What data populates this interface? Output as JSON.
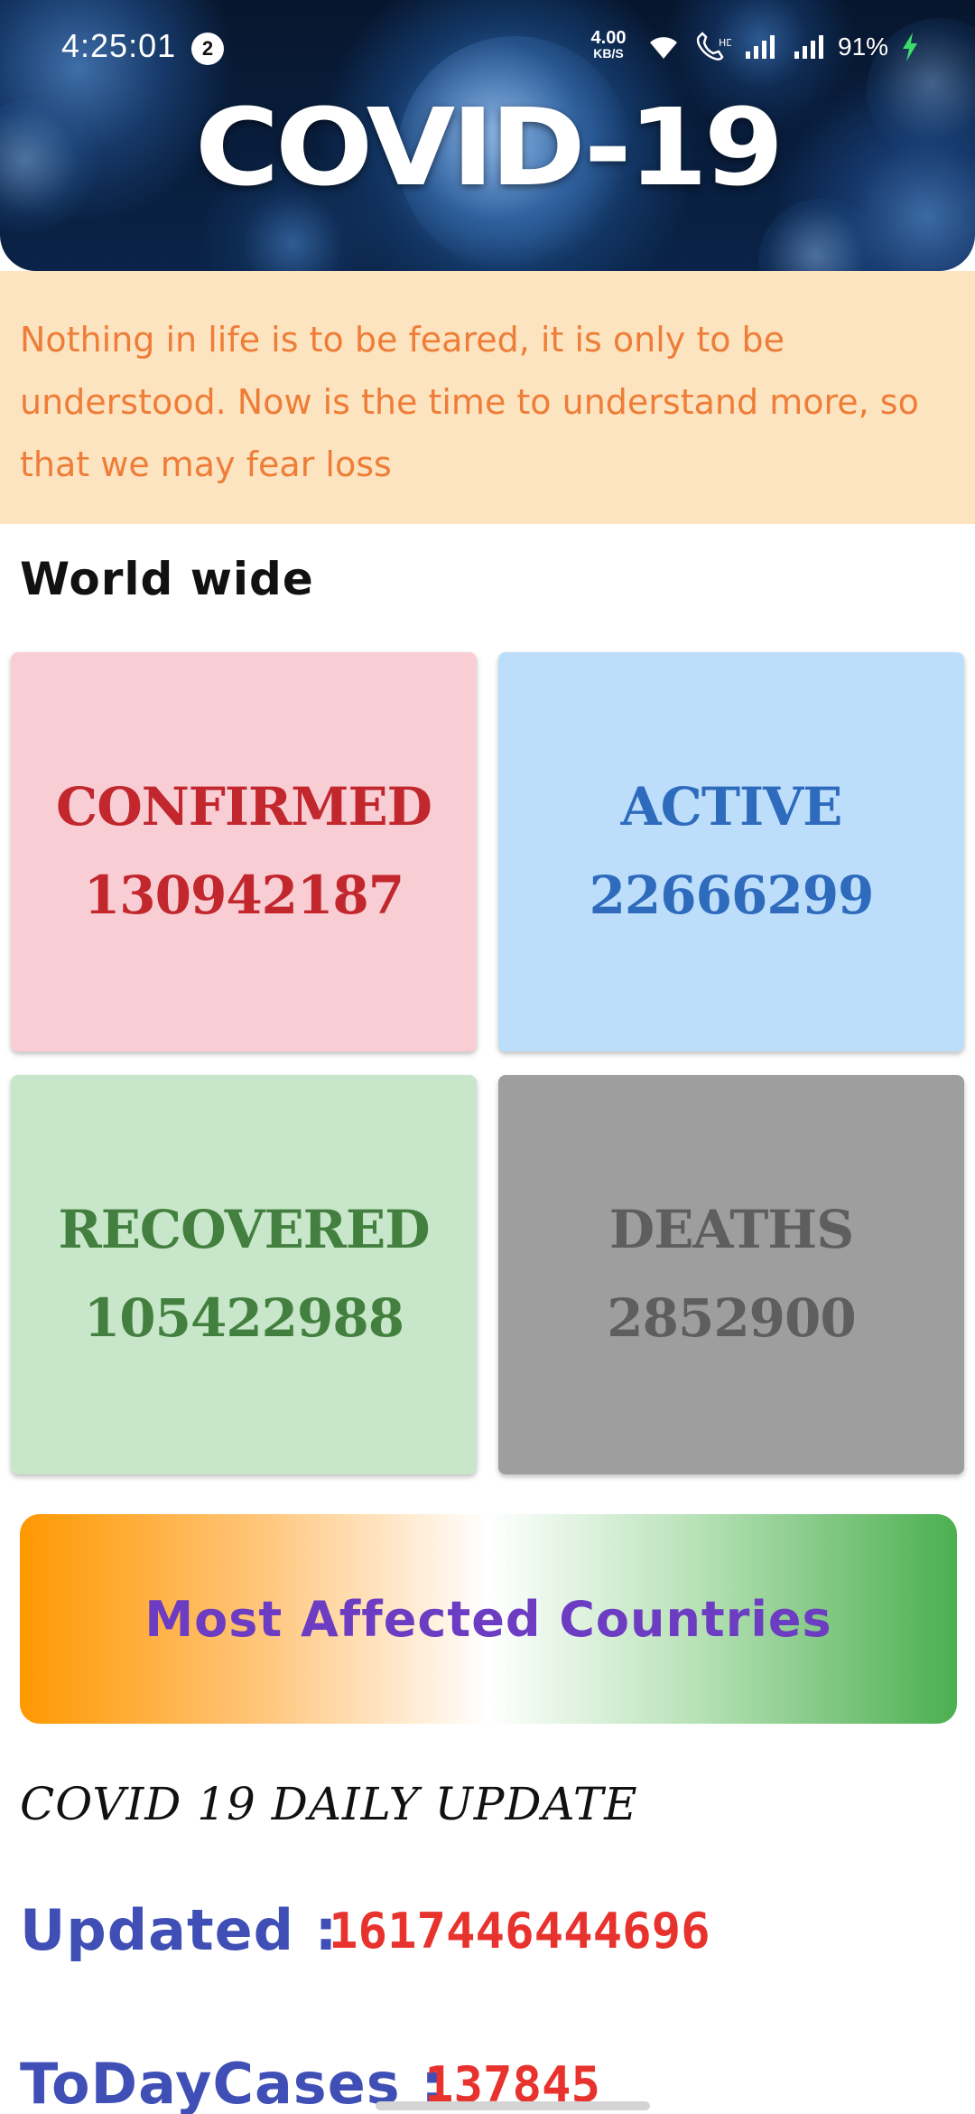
{
  "status_bar": {
    "time": "4:25:01",
    "notification_count": "2",
    "net_speed_value": "4.00",
    "net_speed_unit": "KB/S",
    "battery_percent": "91%",
    "icons": [
      "wifi-icon",
      "volte-call-icon",
      "signal-sim1-icon",
      "signal-sim2-icon",
      "charging-bolt-icon"
    ]
  },
  "header": {
    "title": "COVID-19"
  },
  "quote": {
    "text": "Nothing in life is to be feared, it is only to be understood. Now is the time to understand more, so that we may fear loss"
  },
  "worldwide": {
    "title": "World wide",
    "cards": {
      "confirmed": {
        "label": "CONFIRMED",
        "value": "130942187",
        "bg": "#f8cdd3",
        "color": "#c1272d"
      },
      "active": {
        "label": "ACTIVE",
        "value": "22666299",
        "bg": "#bddefa",
        "color": "#2e6bbd"
      },
      "recovered": {
        "label": "RECOVERED",
        "value": "105422988",
        "bg": "#c8e6c9",
        "color": "#43803f"
      },
      "deaths": {
        "label": "DEATHS",
        "value": "2852900",
        "bg": "#9e9e9e",
        "color": "#5e5e5e"
      }
    }
  },
  "affected_button": {
    "label": "Most Affected Countries"
  },
  "daily_update": {
    "title": "COVID 19 DAILY UPDATE",
    "updated_label": "Updated :",
    "updated_value": "1617446444696",
    "today_cases_label": "ToDayCases :",
    "today_cases_value": "137845"
  },
  "colors": {
    "quote_bg": "#fde4c0",
    "quote_text": "#ee7d38",
    "label_blue": "#3f4fb5",
    "value_red": "#e8322e",
    "button_text": "#6c3cc2"
  }
}
